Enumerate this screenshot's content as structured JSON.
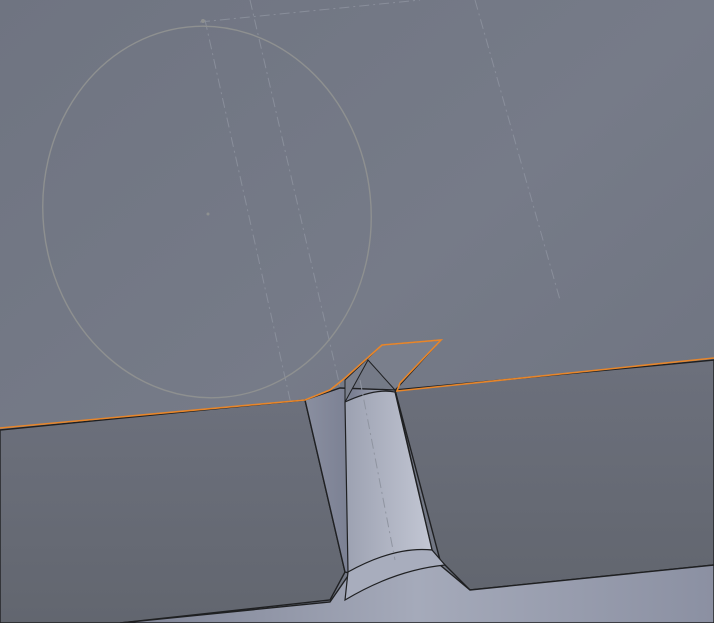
{
  "viewport": {
    "kind": "cad-3d-viewport",
    "background_top": "#737884",
    "background_bottom": "#656a77",
    "top_face_color": "#767b87",
    "front_face_color": "#686c78",
    "bore_highlight": "#b6bac8",
    "bore_shadow": "#6e7384",
    "selected_edge_color": "#e8862a",
    "sketch_curve_color": "#8e9090",
    "construction_line_color": "#8f94a0",
    "edge_color": "#202124"
  },
  "scene": {
    "selected_edges": "top-face-outer-edge",
    "sketch": "elliptical-profile",
    "feature": "counterbored-slot"
  }
}
